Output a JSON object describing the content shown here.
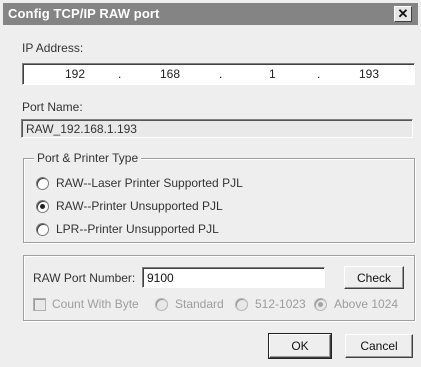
{
  "window": {
    "title": "Config TCP/IP RAW port",
    "close_glyph": "✕"
  },
  "ip_address": {
    "label": "IP Address:",
    "octets": [
      "192",
      "168",
      "1",
      "193"
    ],
    "separator": "."
  },
  "port_name": {
    "label": "Port Name:",
    "value": "RAW_192.168.1.193"
  },
  "printer_type": {
    "legend": "Port & Printer Type",
    "options": [
      {
        "label": "RAW--Laser Printer Supported PJL",
        "checked": false
      },
      {
        "label": "RAW--Printer Unsupported PJL",
        "checked": true
      },
      {
        "label": "LPR--Printer Unsupported PJL",
        "checked": false
      }
    ]
  },
  "raw_port": {
    "label": "RAW Port Number:",
    "value": "9100",
    "check_button": "Check",
    "count_with_byte": "Count With Byte",
    "ranges": [
      {
        "label": "Standard",
        "checked": false
      },
      {
        "label": "512-1023",
        "checked": false
      },
      {
        "label": "Above 1024",
        "checked": true
      }
    ]
  },
  "buttons": {
    "ok": "OK",
    "cancel": "Cancel"
  }
}
